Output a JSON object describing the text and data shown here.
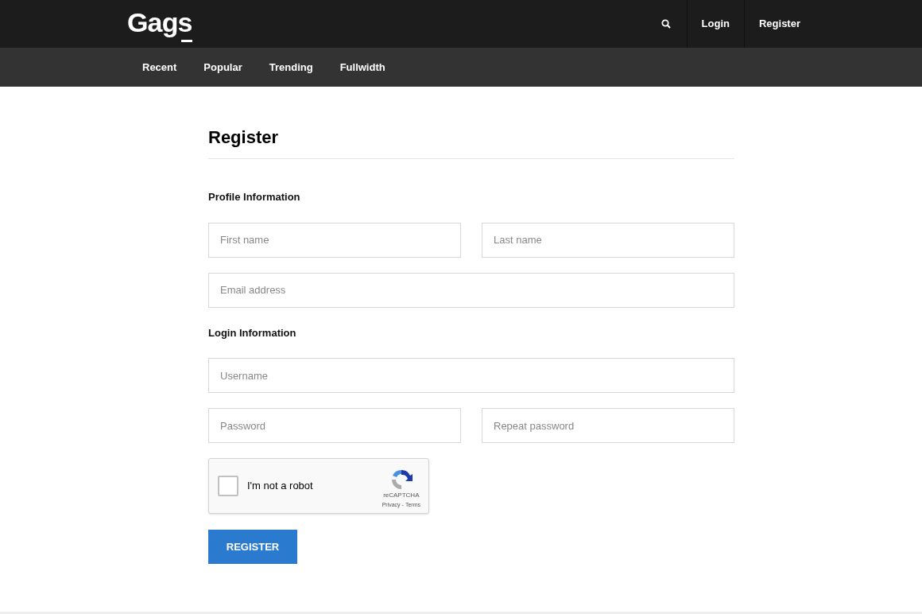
{
  "header": {
    "logo": "Gags",
    "links": [
      "Login",
      "Register"
    ]
  },
  "nav": [
    "Recent",
    "Popular",
    "Trending",
    "Fullwidth"
  ],
  "form": {
    "title": "Register",
    "sections": [
      {
        "heading": "Profile Information",
        "rows": [
          [
            {
              "placeholder": "First name"
            },
            {
              "placeholder": "Last name"
            }
          ],
          [
            {
              "placeholder": "Email address"
            }
          ]
        ]
      },
      {
        "heading": "Login Information",
        "rows": [
          [
            {
              "placeholder": "Username"
            }
          ],
          [
            {
              "placeholder": "Password"
            },
            {
              "placeholder": "Repeat password"
            }
          ]
        ]
      }
    ],
    "captcha": {
      "label": "I'm not a robot",
      "checked": false,
      "brand": "reCAPTCHA",
      "privacy": "Privacy",
      "separator": "-",
      "terms": "Terms"
    },
    "submit": "REGISTER"
  }
}
